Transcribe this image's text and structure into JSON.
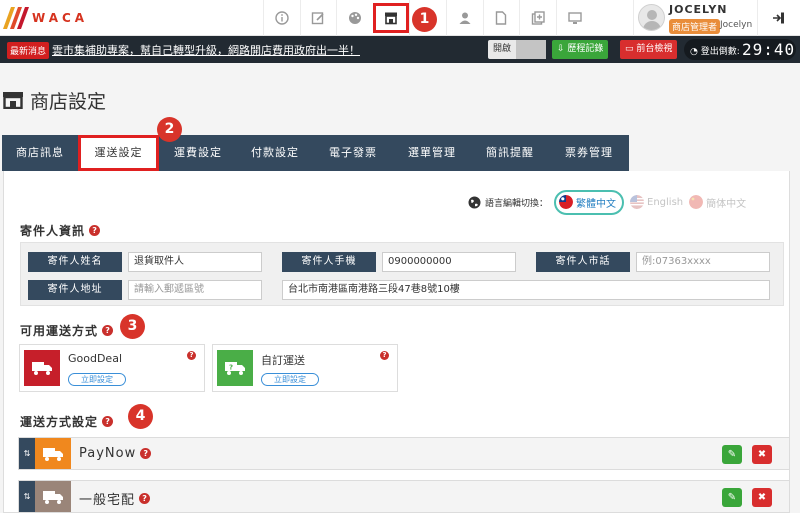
{
  "brand": {
    "logo_text": "WACA",
    "logo_colors": [
      "#e9a321",
      "#e04a2a",
      "#c4172c"
    ]
  },
  "topnav": {
    "icons": [
      "info-icon",
      "edit-icon",
      "palette-icon",
      "store-icon",
      "megaphone-icon",
      "user-icon",
      "file-icon",
      "add-page-icon",
      "monitor-icon"
    ],
    "active_icon": "store-icon"
  },
  "user": {
    "name": "JOCELYN",
    "role": "商店管理者",
    "display_name": "Jocelyn"
  },
  "notice": {
    "tag": "最新消息",
    "text": "雲市集補助專案，幫自己轉型升級，網路開店費用政府出一半！"
  },
  "toolbar": {
    "open_label": "開啟",
    "history_label": "歷程記錄",
    "preview_label": "前台檢視",
    "countdown_label": "登出倒數:",
    "countdown_time": "29:40"
  },
  "page": {
    "title": "商店設定"
  },
  "tabs": [
    {
      "label": "商店訊息"
    },
    {
      "label": "運送設定",
      "active": true
    },
    {
      "label": "運費設定"
    },
    {
      "label": "付款設定"
    },
    {
      "label": "電子發票"
    },
    {
      "label": "選單管理"
    },
    {
      "label": "簡訊提醒"
    },
    {
      "label": "票券管理"
    }
  ],
  "language": {
    "label": "語言編輯切換：",
    "options": [
      {
        "label": "繁體中文",
        "active": true
      },
      {
        "label": "English"
      },
      {
        "label": "簡体中文"
      }
    ]
  },
  "sender": {
    "title": "寄件人資訊",
    "fields": {
      "name_label": "寄件人姓名",
      "name_value": "退貨取件人",
      "mobile_label": "寄件人手機",
      "mobile_value": "0900000000",
      "phone_label": "寄件人市話",
      "phone_placeholder": "例:07363xxxx",
      "address_label": "寄件人地址",
      "zip_placeholder": "請輸入郵遞區號",
      "address_value": "台北市南港區南港路三段47巷8號10樓"
    }
  },
  "available": {
    "title": "可用運送方式",
    "cards": [
      {
        "name": "GoodDeal",
        "setup_label": "立即設定",
        "color": "#c61f2a"
      },
      {
        "name": "自訂運送",
        "setup_label": "立即設定",
        "color": "#4aae47"
      }
    ]
  },
  "methods": {
    "title": "運送方式設定",
    "rows": [
      {
        "name": "PayNow",
        "color": "#f0881e"
      },
      {
        "name": "一般宅配",
        "color": "#9a8579"
      }
    ]
  },
  "steps": [
    "1",
    "2",
    "3",
    "4"
  ]
}
